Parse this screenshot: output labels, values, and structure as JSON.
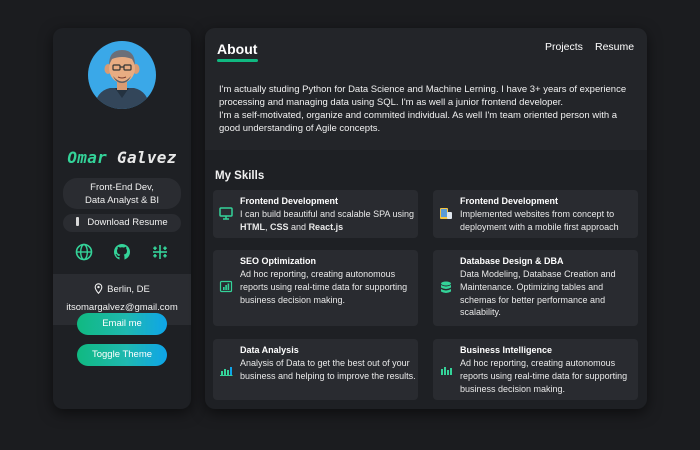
{
  "profile": {
    "first_name": "Omar",
    "last_name": "Galvez",
    "role_line1": "Front-End Dev,",
    "role_line2": "Data Analyst & BI",
    "download_label": "Download Resume",
    "socials": [
      "globe-icon",
      "github-icon",
      "tableau-icon"
    ],
    "location": "Berlin, DE",
    "email": "itsomargalvez@gmail.com"
  },
  "buttons": {
    "email_label": "Email me",
    "theme_label": "Toggle Theme"
  },
  "nav": {
    "about": "About",
    "projects": "Projects",
    "resume": "Resume"
  },
  "about": {
    "paragraph1": "I'm actually studing Python for Data Science and Machine Lerning. I have 3+ years of experience processing and managing data using SQL. I'm as well a junior frontend developer.",
    "paragraph2": "I'm a self-motivated, organize and commited individual. As well I'm team oriented person with a good understanding of Agile concepts."
  },
  "skills": {
    "title": "My Skills",
    "items": [
      {
        "title": "Frontend Development",
        "icon": "monitor-icon",
        "desc_pre": "I can build beautiful and scalable SPA using ",
        "html": "HTML",
        "sep1": ", ",
        "css": "CSS",
        "sep2": " and ",
        "react": "React.js"
      },
      {
        "title": "Frontend Development",
        "icon": "devices-icon",
        "desc": "Implemented websites from concept to deployment with a mobile first approach"
      },
      {
        "title": "SEO Optimization",
        "icon": "bar-chart-icon",
        "desc": "Ad hoc reporting, creating autonomous reports using real-time data for supporting business decision making."
      },
      {
        "title": "Database Design & DBA",
        "icon": "database-icon",
        "desc": "Data Modeling, Database Creation and Maintenance. Optimizing tables and schemas for better performance and scalability."
      },
      {
        "title": "Data Analysis",
        "icon": "line-chart-icon",
        "desc": "Analysis of Data to get the best out of your business and helping to improve the results."
      },
      {
        "title": "Business Intelligence",
        "icon": "bar-chart-icon",
        "desc": "Ad hoc reporting, creating autonomous reports using real-time data for supporting business decision making."
      }
    ]
  },
  "colors": {
    "accent": "#10b981",
    "accent_blue": "#0ea5e9",
    "card_bg": "#1e2024",
    "skill_bg": "#292b30",
    "page_bg": "#1b1c1f"
  }
}
